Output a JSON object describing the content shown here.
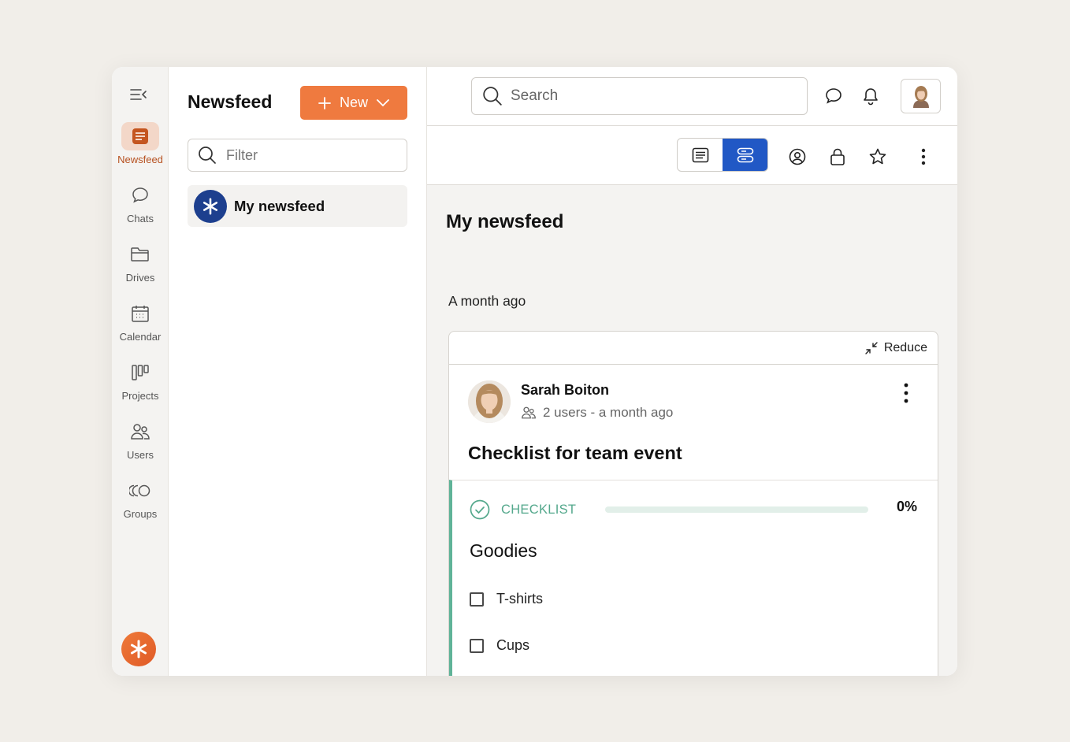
{
  "rail": {
    "items": [
      {
        "label": "Newsfeed",
        "icon": "newsfeed-icon",
        "active": true
      },
      {
        "label": "Chats",
        "icon": "chat-bubble-icon"
      },
      {
        "label": "Drives",
        "icon": "folder-icon"
      },
      {
        "label": "Calendar",
        "icon": "calendar-icon"
      },
      {
        "label": "Projects",
        "icon": "kanban-icon"
      },
      {
        "label": "Users",
        "icon": "users-icon"
      },
      {
        "label": "Groups",
        "icon": "groups-icon"
      }
    ]
  },
  "side": {
    "title": "Newsfeed",
    "new_label": "New",
    "filter_placeholder": "Filter",
    "feeds": [
      {
        "label": "My newsfeed"
      }
    ]
  },
  "topbar": {
    "search_placeholder": "Search"
  },
  "main": {
    "title": "My newsfeed",
    "date_label": "A month ago"
  },
  "post": {
    "reduce_label": "Reduce",
    "author": "Sarah Boiton",
    "meta": "2 users - a month ago",
    "title": "Checklist for team event",
    "checklist": {
      "label": "CHECKLIST",
      "percent_text": "0%",
      "progress": 0,
      "title": "Goodies",
      "items": [
        {
          "label": "T-shirts",
          "checked": false
        },
        {
          "label": "Cups",
          "checked": false
        }
      ]
    }
  },
  "colors": {
    "accent": "#ef7a3f",
    "primary_blue": "#2158c5",
    "checklist_green": "#5fb398",
    "feed_avatar": "#1d3f8e"
  }
}
